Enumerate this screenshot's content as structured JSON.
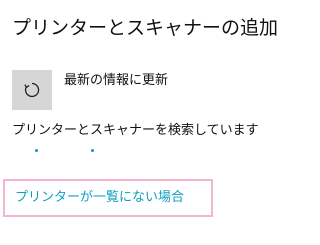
{
  "page": {
    "title": "プリンターとスキャナーの追加"
  },
  "refresh": {
    "icon": "refresh-icon",
    "label": "最新の情報に更新"
  },
  "status": {
    "searching_text": "プリンターとスキャナーを検索しています"
  },
  "link": {
    "not_listed": "プリンターが一覧にない場合"
  },
  "colors": {
    "accent": "#0a9bbf",
    "link": "#109fbf",
    "highlight_border": "#f4b4d4",
    "button_bg": "#d6d6d6"
  }
}
